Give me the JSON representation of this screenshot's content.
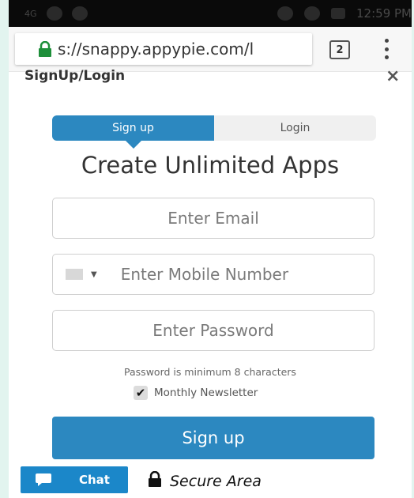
{
  "status_bar": {
    "signal": "4G",
    "time": "12:59 PM"
  },
  "browser": {
    "url": "s://snappy.appypie.com/l",
    "tab_count": "2"
  },
  "modal": {
    "title": "SignUp/Login",
    "close": "×"
  },
  "tabs": {
    "signup": "Sign up",
    "login": "Login"
  },
  "form": {
    "heading": "Create Unlimited Apps",
    "email_placeholder": "Enter Email",
    "mobile_placeholder": "Enter Mobile Number",
    "password_placeholder": "Enter Password",
    "password_hint": "Password is minimum 8 characters",
    "newsletter_label": "Monthly Newsletter",
    "newsletter_checked": true,
    "submit_label": "Sign up"
  },
  "footer": {
    "chat_label": "Chat",
    "secure_label": "Secure Area"
  },
  "colors": {
    "accent": "#2c88c0",
    "chat": "#1b87c9",
    "backdrop": "#e2f4ef"
  }
}
